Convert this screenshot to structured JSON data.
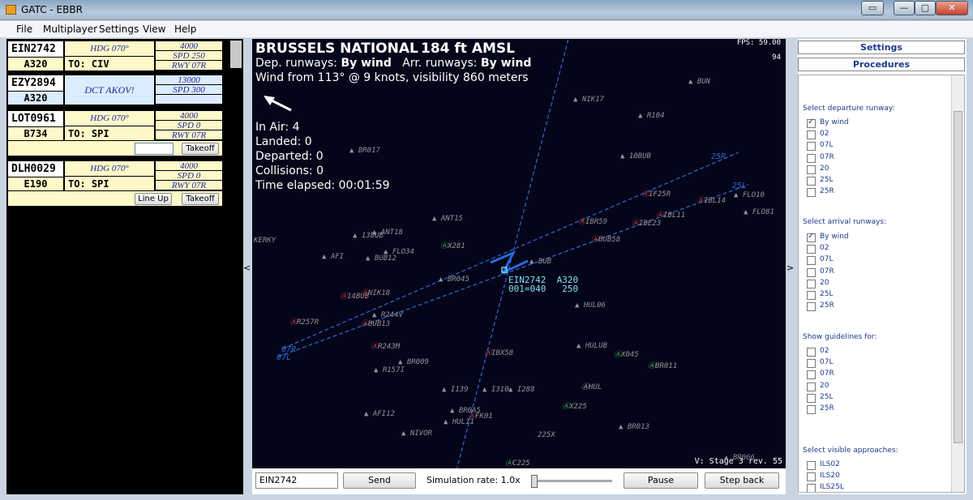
{
  "window": {
    "title": "GATC - EBBR",
    "min": "—",
    "max": "▢",
    "close": "✕",
    "extra": "▭"
  },
  "menu": [
    "File",
    "Multiplayer",
    "Settings",
    "View",
    "Help"
  ],
  "strips": [
    {
      "callsign": "EIN2742",
      "type": "A320",
      "instr": "HDG 070°",
      "to": "TO:  CIV",
      "alt": "4000",
      "spd": "SPD 250",
      "rwy": "RWY 07R",
      "buttons": []
    },
    {
      "callsign": "EZY2894",
      "type": "A320",
      "dct": "DCT AKOV!",
      "alt": "13000",
      "spd": "SPD 300",
      "buttons": []
    },
    {
      "callsign": "LOT0961",
      "type": "B734",
      "instr": "HDG 070°",
      "to": "TO:  SPI",
      "alt": "4000",
      "spd": "SPD 0",
      "rwy": "RWY 07R",
      "buttons": [
        "Takeoff"
      ]
    },
    {
      "callsign": "DLH0029",
      "type": "E190",
      "instr": "HDG 070°",
      "to": "TO:  SPI",
      "alt": "4000",
      "spd": "SPD 0",
      "rwy": "RWY 07R",
      "buttons": [
        "Line Up",
        "Takeoff"
      ]
    }
  ],
  "radar": {
    "airport": "BRUSSELS NATIONAL",
    "elevation": "184 ft AMSL",
    "dep_label": "Dep. runways:",
    "dep_value": "By wind",
    "arr_label": "Arr. runways:",
    "arr_value": "By wind",
    "wind": "Wind from 113° @ 9 knots, visibility 860 meters",
    "in_air": "In Air: 4",
    "landed": "Landed: 0",
    "departed": "Departed: 0",
    "collisions": "Collisions: 0",
    "elapsed": "Time elapsed: 00:01:59",
    "fps": "FPS: 59.00",
    "fps_sub": "94",
    "version": "V: Stage 3 rev. 55",
    "aircraft_label": "EIN2742  A320\n001=040   250",
    "runway_labels": [
      "25R",
      "25L",
      "07R",
      "07L"
    ],
    "waypoints": [
      "BUN",
      "NIK17",
      "R104",
      "10BUB",
      "BR017",
      "FLO10",
      "FLO81",
      "ANT15",
      "KERKY",
      "13BUB",
      "ANT18",
      "AFI",
      "BUB12",
      "FLO34",
      "BUB",
      "BR045",
      "HUL06",
      "R244V",
      "R157I",
      "BR009",
      "I139",
      "I310",
      "I288",
      "BR0A5",
      "HUL11",
      "AFI12",
      "NIVOR",
      "225X",
      "BR013",
      "HULUB",
      "BR066"
    ],
    "red_waypoints": [
      "IF25R",
      "IBL14",
      "IBL11",
      "IBR59",
      "IBE23",
      "BUB58",
      "14BUB",
      "NIK18",
      "R257R",
      "BUB13",
      "R243M",
      "IBX58",
      "FK01"
    ],
    "green_waypoints": [
      "X281",
      "X045",
      "BR011",
      "HUL",
      "X225",
      "C225"
    ]
  },
  "controls": {
    "command": "EIN2742",
    "send": "Send",
    "sim_rate": "Simulation rate: 1.0x",
    "sim_rate_fraction": 0.0,
    "pause": "Pause",
    "step_back": "Step back"
  },
  "side": {
    "settings": "Settings",
    "procedures": "Procedures",
    "dep_title": "Select departure runway:",
    "dep_options": [
      "By wind",
      "02",
      "07L",
      "07R",
      "20",
      "25L",
      "25R"
    ],
    "dep_checked": 0,
    "arr_title": "Select arrival runways:",
    "arr_options": [
      "By wind",
      "02",
      "07L",
      "07R",
      "20",
      "25L",
      "25R"
    ],
    "arr_checked": 0,
    "guide_title": "Show guidelines for:",
    "guide_options": [
      "02",
      "07L",
      "07R",
      "20",
      "25L",
      "25R"
    ],
    "app_title": "Select visible approaches:",
    "app_options": [
      "ILS02",
      "ILS20",
      "ILS25L"
    ]
  },
  "colors": {
    "radar_bg": "#05051a",
    "strip_yellow": "#fff8c8",
    "strip_blue": "#dcecff",
    "runway": "#2a6ad8",
    "ink": "#1a2aa0"
  }
}
